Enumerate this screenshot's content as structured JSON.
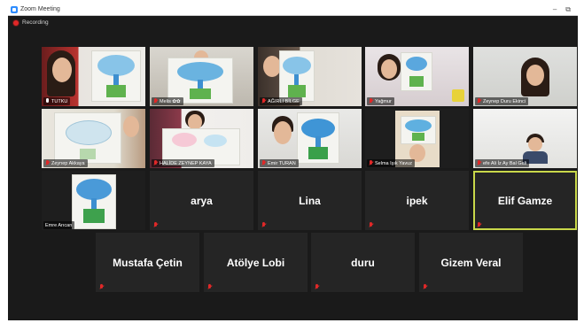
{
  "window": {
    "title": "Zoom Meeting",
    "minimize_label": "–",
    "restore_label": "⧉"
  },
  "recording": {
    "label": "Recording"
  },
  "colors": {
    "accent_active": "#c9d84a",
    "muted_red": "#e02828",
    "background": "#1a1a1a"
  },
  "participants": [
    {
      "name": "TUTKU",
      "muted": false
    },
    {
      "name": "Melis ✿✿",
      "muted": true
    },
    {
      "name": "AĞIRLI BİLGE",
      "muted": true
    },
    {
      "name": "Yağmur",
      "muted": true
    },
    {
      "name": "Zeynep Duru Ekinci",
      "muted": true
    },
    {
      "name": "Zeynep Akkaya",
      "muted": true
    },
    {
      "name": "HALİDE ZEYNEP KAYA",
      "muted": true
    },
    {
      "name": "Emir TURAN",
      "muted": true
    },
    {
      "name": "Selma Işık Yavuz",
      "muted": true
    },
    {
      "name": "efe Ali İz Ay Bal Gali",
      "muted": true
    },
    {
      "name": "Emre Arıcan",
      "muted": true
    },
    {
      "name": "arya",
      "muted": true
    },
    {
      "name": "Lina",
      "muted": true
    },
    {
      "name": "ipek",
      "muted": true
    },
    {
      "name": "Elif Gamze",
      "muted": true,
      "active": true
    },
    {
      "name": "Mustafa Çetin",
      "muted": true
    },
    {
      "name": "Atölye Lobi",
      "muted": true
    },
    {
      "name": "duru",
      "muted": true
    },
    {
      "name": "Gizem Veral",
      "muted": true
    }
  ]
}
